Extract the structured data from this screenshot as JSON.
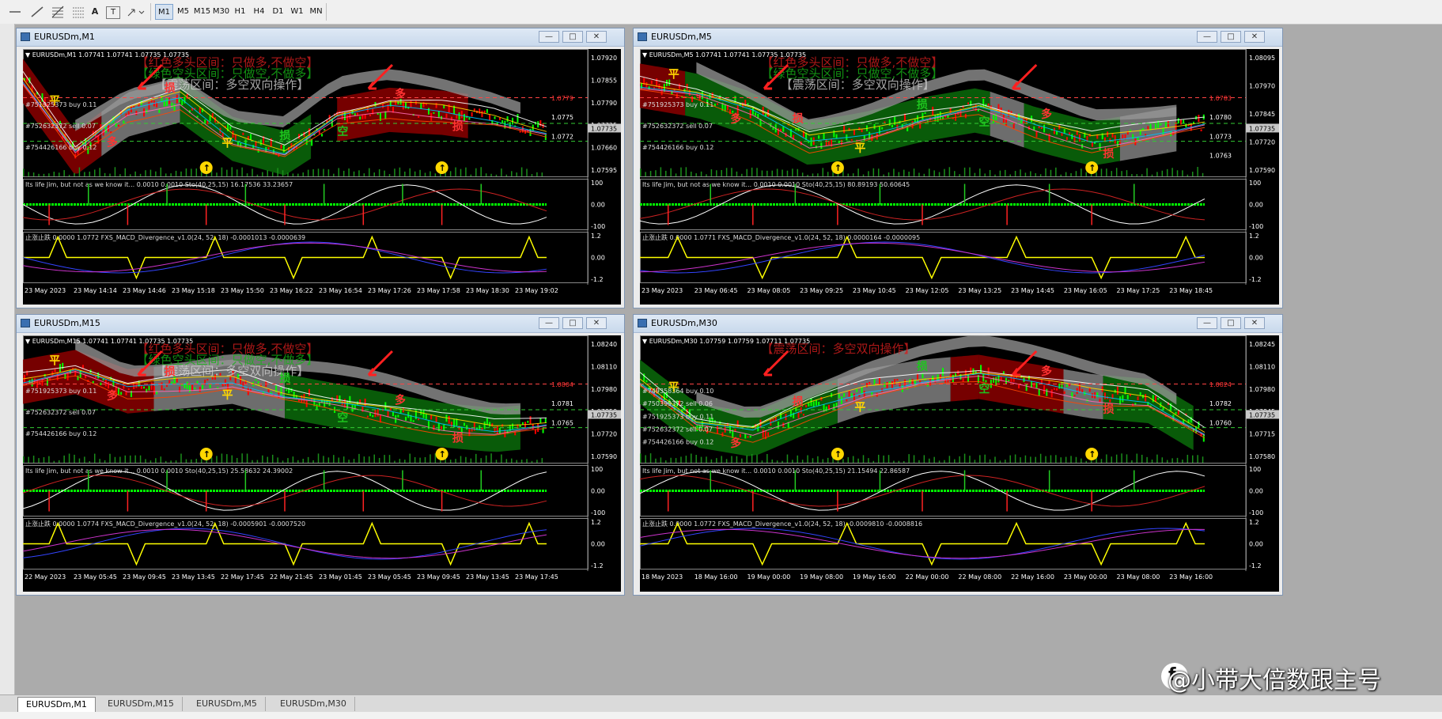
{
  "toolbar": {
    "draw_tools": [
      "line-icon",
      "hline-icon",
      "fibo-icon",
      "grid-icon",
      "text-icon",
      "label-icon",
      "arrow-icon"
    ],
    "text_tool": "A",
    "label_tool": "T",
    "timeframes": [
      "M1",
      "M5",
      "M15",
      "M30",
      "H1",
      "H4",
      "D1",
      "W1",
      "MN"
    ],
    "active_timeframe": "M1"
  },
  "windows": [
    {
      "title": "EURUSDm,M1",
      "ohlc": "EURUSDm,M1 1.07741 1.07741 1.07735 1.07735",
      "banners": [
        "【红色多头区间：只做多,不做空】",
        "【绿色空头区间：只做空,不做多】",
        "【震荡区间：多空双向操作】"
      ],
      "price_labels": [
        "1.07920",
        "1.07855",
        "1.07790",
        "1.07725",
        "1.07660",
        "1.07595"
      ],
      "current_price": "1.07735",
      "orders": [
        "#751925373 buy 0.11",
        "#752632372 sell 0.07",
        "#754426166 buy 0.12"
      ],
      "level_labels": [
        "1.0779",
        "1.0775",
        "1.0772"
      ],
      "ind1": "Its life Jim, but not as we know it... 0.0010 0.0010  Sto(40,25,15) 16.17536 33.23657",
      "ind1_scale": [
        "100",
        "0.00",
        "-100"
      ],
      "ind2": "止涨止跌 0.0000 1.0772  FXS_MACD_Divergence_v1.0(24, 52, 18) -0.0001013 -0.0000639",
      "ind2_scale": [
        "1.2",
        "0.00",
        "-1.2"
      ],
      "times": [
        "23 May 2023",
        "23 May 14:14",
        "23 May 14:46",
        "23 May 15:18",
        "23 May 15:50",
        "23 May 16:22",
        "23 May 16:54",
        "23 May 17:26",
        "23 May 17:58",
        "23 May 18:30",
        "23 May 19:02"
      ]
    },
    {
      "title": "EURUSDm,M5",
      "ohlc": "EURUSDm,M5 1.07741 1.07741 1.07735 1.07735",
      "banners": [
        "【红色多头区间：只做多,不做空】",
        "【绿色空头区间：只做空,不做多】",
        "【震荡区间：多空双向操作】"
      ],
      "price_labels": [
        "1.08095",
        "1.07970",
        "1.07845",
        "1.07720",
        "1.07590"
      ],
      "current_price": "1.07735",
      "orders": [
        "#751925373 buy 0.11",
        "#752632372 sell 0.07",
        "#754426166 buy 0.12"
      ],
      "level_labels": [
        "1.0783",
        "1.0780",
        "1.0773",
        "1.0763"
      ],
      "ind1": "Its life Jim, but not as we know it... 0.0010 0.0010  Sto(40,25,15) 80.89193 50.60645",
      "ind1_scale": [
        "100",
        "0.00",
        "-100"
      ],
      "ind2": "止涨止跌 0.0000 1.0771  FXS_MACD_Divergence_v1.0(24, 52, 18) 0.0000164 -0.0000095",
      "ind2_scale": [
        "1.2",
        "0.00",
        "-1.2"
      ],
      "times": [
        "23 May 2023",
        "23 May 06:45",
        "23 May 08:05",
        "23 May 09:25",
        "23 May 10:45",
        "23 May 12:05",
        "23 May 13:25",
        "23 May 14:45",
        "23 May 16:05",
        "23 May 17:25",
        "23 May 18:45"
      ]
    },
    {
      "title": "EURUSDm,M15",
      "ohlc": "EURUSDm,M15 1.07741 1.07741 1.07735 1.07735",
      "banners": [
        "【红色多头区间：只做多,不做空】",
        "【绿色空头区间：只做空,不做多】",
        "【震荡区间：多空双向操作】"
      ],
      "price_labels": [
        "1.08240",
        "1.08110",
        "1.07980",
        "1.07850",
        "1.07720",
        "1.07590"
      ],
      "current_price": "1.07735",
      "orders": [
        "#751925373 buy 0.11",
        "#752632372 sell 0.07",
        "#754426166 buy 0.12"
      ],
      "level_labels": [
        "1.0804",
        "1.0781",
        "1.0765"
      ],
      "ind1": "Its life Jim, but not as we know it... 0.0010 0.0010  Sto(40,25,15) 25.58632 24.39002",
      "ind1_scale": [
        "100",
        "0.00",
        "-100"
      ],
      "ind2": "止涨止跌 0.0000 1.0774  FXS_MACD_Divergence_v1.0(24, 52, 18) -0.0005901 -0.0007520",
      "ind2_scale": [
        "1.2",
        "0.00",
        "-1.2"
      ],
      "times": [
        "22 May 2023",
        "23 May 05:45",
        "23 May 09:45",
        "23 May 13:45",
        "22 May 17:45",
        "22 May 21:45",
        "23 May 01:45",
        "23 May 05:45",
        "23 May 09:45",
        "23 May 13:45",
        "23 May 17:45"
      ]
    },
    {
      "title": "EURUSDm,M30",
      "ohlc": "EURUSDm,M30 1.07759 1.07759 1.07711 1.07735",
      "banners": [
        "【震荡区间：多空双向操作】"
      ],
      "price_labels": [
        "1.08245",
        "1.08110",
        "1.07980",
        "1.07845",
        "1.07715",
        "1.07580"
      ],
      "current_price": "1.07735",
      "orders": [
        "#749358364 buy 0.10",
        "#750399372 sell 0.06",
        "#751925373 buy 0.11",
        "#752632372 sell 0.07",
        "#754426166 buy 0.12"
      ],
      "level_labels": [
        "1.0824",
        "1.0782",
        "1.0760"
      ],
      "ind1": "Its life Jim, but not as we know it... 0.0010 0.0010  Sto(40,25,15) 21.15494 22.86587",
      "ind1_scale": [
        "100",
        "0.00",
        "-100"
      ],
      "ind2": "止涨止跌 0.0000 1.0772  FXS_MACD_Divergence_v1.0(24, 52, 18) -0.0009810 -0.0008816",
      "ind2_scale": [
        "1.2",
        "0.00",
        "-1.2"
      ],
      "times": [
        "18 May 2023",
        "18 May 16:00",
        "19 May 00:00",
        "19 May 08:00",
        "19 May 16:00",
        "22 May 00:00",
        "22 May 08:00",
        "22 May 16:00",
        "23 May 00:00",
        "23 May 08:00",
        "23 May 16:00"
      ]
    }
  ],
  "marks": {
    "buy": "多",
    "sell": "空",
    "close": "平",
    "stop": "损",
    "up_arrow": "↑"
  },
  "bottom_tabs": [
    "EURUSDm,M1",
    "EURUSDm,M15",
    "EURUSDm,M5",
    "EURUSDm,M30"
  ],
  "watermark": "@小带大倍数跟主号",
  "window_buttons": {
    "min": "—",
    "max": "□",
    "close": "✕"
  },
  "colors": {
    "bull_zone": "#8b0000",
    "bear_zone": "#0a6b0a",
    "range_zone": "#808080",
    "bull_text": "#d81e1e",
    "bear_text": "#17b417",
    "candle_up": "#00ff00",
    "candle_dn": "#ff0000"
  }
}
